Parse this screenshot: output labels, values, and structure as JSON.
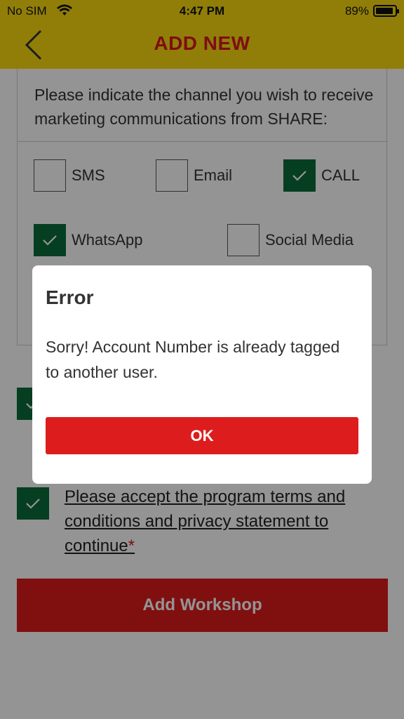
{
  "status_bar": {
    "carrier": "No SIM",
    "time": "4:47 PM",
    "battery_pct": "89%"
  },
  "header": {
    "title": "ADD NEW"
  },
  "form": {
    "channel_prompt": "Please indicate the channel you wish to receive marketing communications from SHARE:",
    "channels": [
      {
        "label": "SMS",
        "checked": false
      },
      {
        "label": "Email",
        "checked": false
      },
      {
        "label": "CALL",
        "checked": true
      },
      {
        "label": "WhatsApp",
        "checked": true
      },
      {
        "label": "Social Media",
        "checked": false
      }
    ],
    "terms_text": "Please accept the program terms and conditions and privacy statement to continue",
    "terms_required_mark": "*",
    "terms_checked": true,
    "add_button": "Add Workshop"
  },
  "dialog": {
    "title": "Error",
    "message": "Sorry! Account Number is already tagged to another user.",
    "ok_label": "OK"
  },
  "colors": {
    "header_bg": "#f8d90f",
    "brand_red": "#dd1d1d",
    "check_green": "#0b6b3a"
  }
}
